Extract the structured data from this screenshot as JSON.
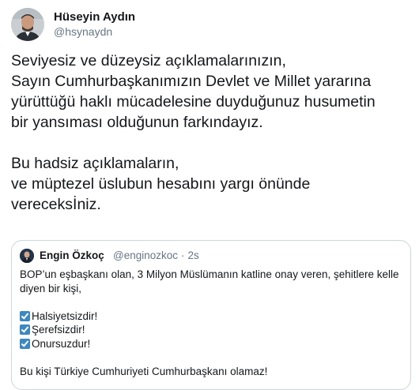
{
  "tweet": {
    "author": {
      "name": "Hüseyin Aydın",
      "handle": "@hsynaydn"
    },
    "text_lines": [
      "Seviyesiz ve düzeysiz açıklamalarınızın,",
      "Sayın Cumhurbaşkanımızın Devlet ve Millet yararına",
      "yürüttüğü haklı mücadelesine duyduğunuz husumetin",
      "bir yansıması olduğunun farkındayız.",
      "",
      "Bu hadsiz açıklamaların,",
      "ve müptezel üslubun hesabını yargı önünde",
      "vereceksİniz."
    ]
  },
  "quoted_tweet": {
    "author": {
      "name": "Engin Özkoç",
      "handle": "@enginozkoc",
      "separator": "·",
      "time": "2s"
    },
    "lines": [
      "BOP’un eşbaşkanı olan, 3 Milyon Müslümanın katline onay veren, şehitlere kelle",
      "diyen bir kişi,"
    ],
    "checklist": [
      "Halsiyetsizdir!",
      "Şerefsizdir!",
      "Onursuzdur!"
    ],
    "closing": "Bu kişi Türkiye Cumhuriyeti Cumhurbaşkanı olamaz!"
  },
  "colors": {
    "text": "#14171a",
    "secondary": "#657786",
    "border": "#ccd6dd",
    "check": "#3b88c3"
  }
}
